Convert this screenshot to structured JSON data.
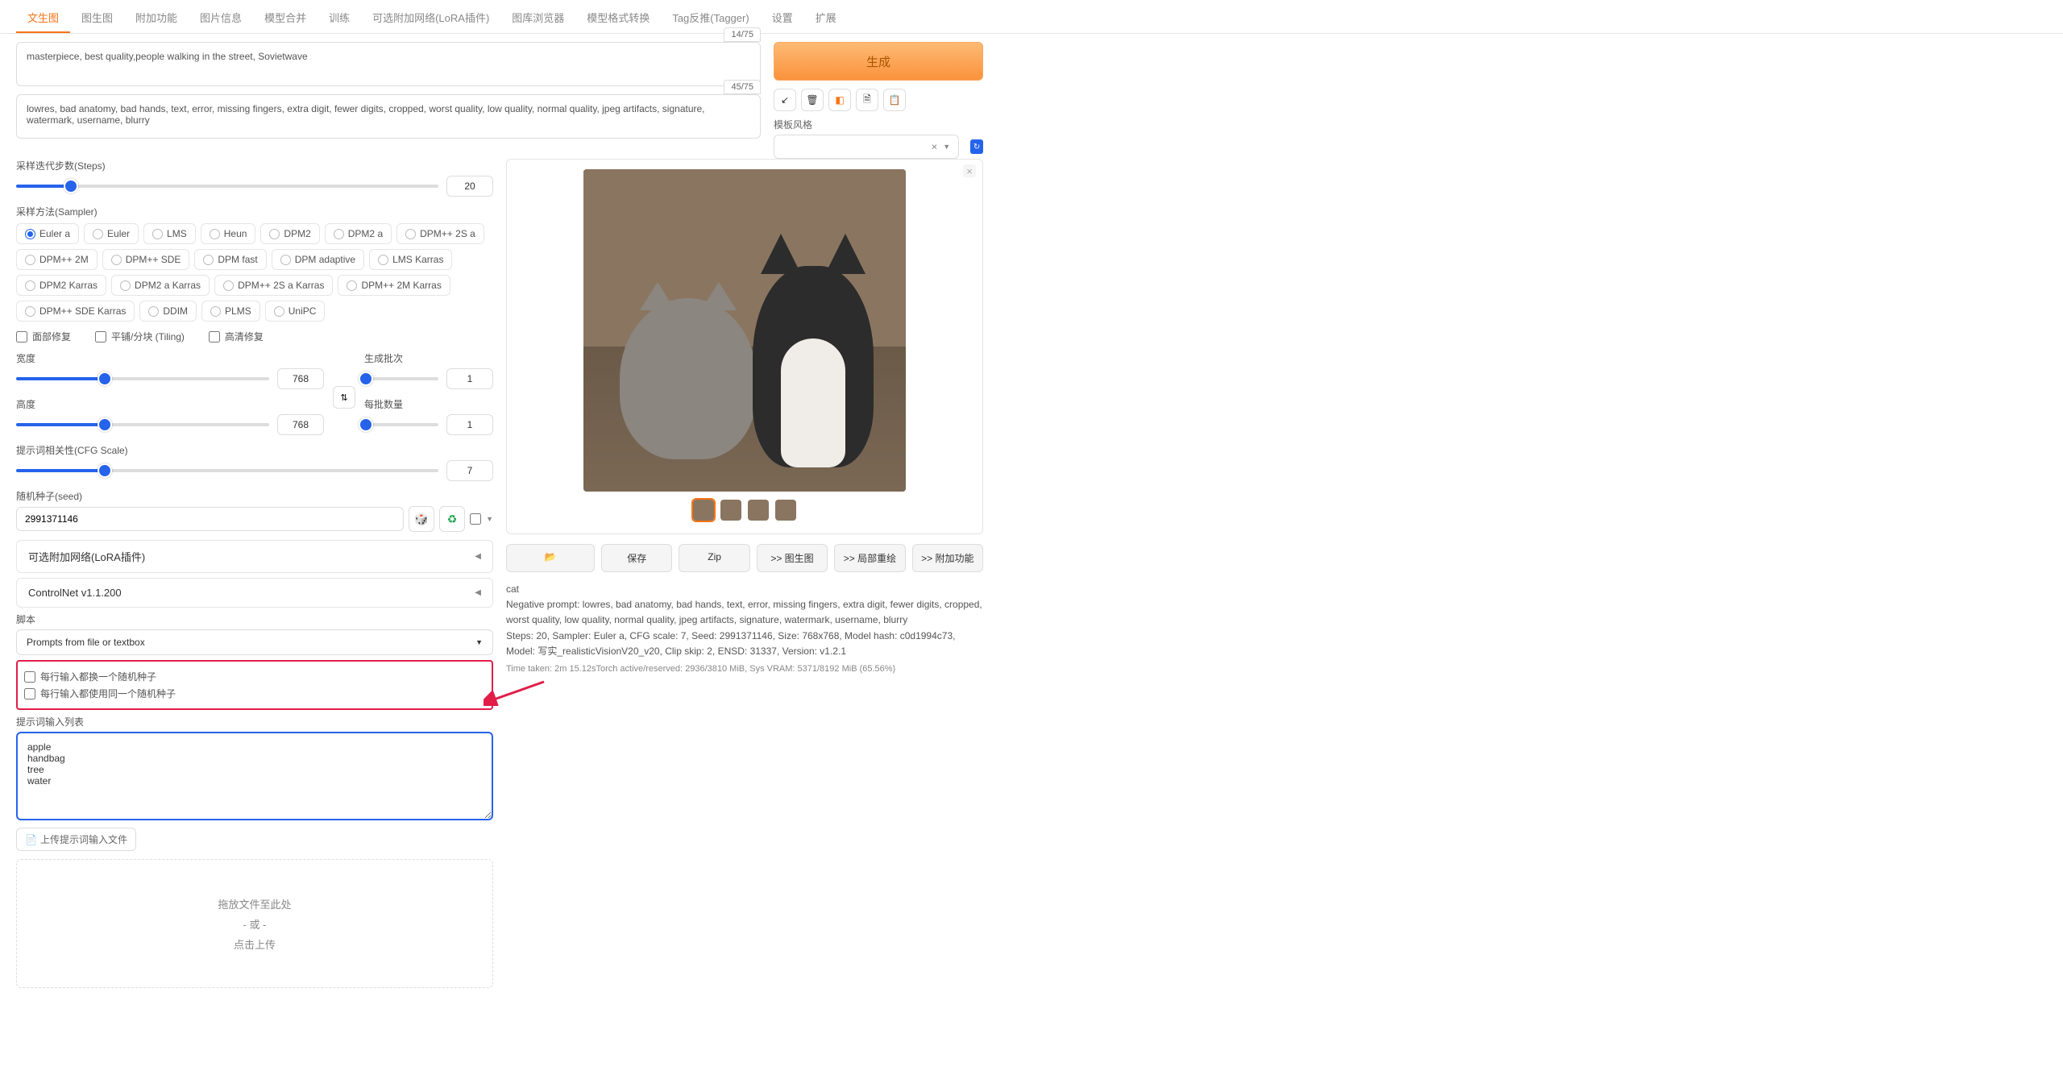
{
  "tabs": {
    "t0": "文生图",
    "t1": "图生图",
    "t2": "附加功能",
    "t3": "图片信息",
    "t4": "模型合并",
    "t5": "训练",
    "t6": "可选附加网络(LoRA插件)",
    "t7": "图库浏览器",
    "t8": "模型格式转换",
    "t9": "Tag反推(Tagger)",
    "t10": "设置",
    "t11": "扩展"
  },
  "prompt": {
    "positive": "masterpiece, best quality,people walking in the street, Sovietwave",
    "pos_count": "14/75",
    "negative": "lowres, bad anatomy, bad hands, text, error, missing fingers, extra digit, fewer digits, cropped, worst quality, low quality, normal quality, jpeg artifacts, signature, watermark, username, blurry",
    "neg_count": "45/75"
  },
  "generate": "生成",
  "style_label": "模板风格",
  "params": {
    "steps_label": "采样迭代步数(Steps)",
    "steps_val": "20",
    "sampler_label": "采样方法(Sampler)",
    "samplers": {
      "s0": "Euler a",
      "s1": "Euler",
      "s2": "LMS",
      "s3": "Heun",
      "s4": "DPM2",
      "s5": "DPM2 a",
      "s6": "DPM++ 2S a",
      "s7": "DPM++ 2M",
      "s8": "DPM++ SDE",
      "s9": "DPM fast",
      "s10": "DPM adaptive",
      "s11": "LMS Karras",
      "s12": "DPM2 Karras",
      "s13": "DPM2 a Karras",
      "s14": "DPM++ 2S a Karras",
      "s15": "DPM++ 2M Karras",
      "s16": "DPM++ SDE Karras",
      "s17": "DDIM",
      "s18": "PLMS",
      "s19": "UniPC"
    },
    "check_face": "面部修复",
    "check_tile": "平铺/分块 (Tiling)",
    "check_hires": "高清修复",
    "width_label": "宽度",
    "width_val": "768",
    "height_label": "高度",
    "height_val": "768",
    "batch_count_label": "生成批次",
    "batch_count_val": "1",
    "batch_size_label": "每批数量",
    "batch_size_val": "1",
    "cfg_label": "提示词相关性(CFG Scale)",
    "cfg_val": "7",
    "seed_label": "随机种子(seed)",
    "seed_val": "2991371146"
  },
  "accordions": {
    "lora": "可选附加网络(LoRA插件)",
    "controlnet": "ControlNet v1.1.200"
  },
  "script": {
    "label": "脚本",
    "selected": "Prompts from file or textbox"
  },
  "script_opts": {
    "c1": "每行输入都换一个随机种子",
    "c2": "每行输入都使用同一个随机种子",
    "list_label": "提示词输入列表",
    "list_val": "apple\nhandbag\ntree\nwater",
    "upload": "上传提示词输入文件",
    "drop1": "拖放文件至此处",
    "drop2": "- 或 -",
    "drop3": "点击上传"
  },
  "actions": {
    "save": "保存",
    "zip": "Zip",
    "img2img": ">> 图生图",
    "inpaint": ">> 局部重绘",
    "extras": ">> 附加功能"
  },
  "info": {
    "l1": "cat",
    "l2": "Negative prompt: lowres, bad anatomy, bad hands, text, error, missing fingers, extra digit, fewer digits, cropped, worst quality, low quality, normal quality, jpeg artifacts, signature, watermark, username, blurry",
    "l3": "Steps: 20, Sampler: Euler a, CFG scale: 7, Seed: 2991371146, Size: 768x768, Model hash: c0d1994c73, Model: 写实_realisticVisionV20_v20, Clip skip: 2, ENSD: 31337, Version: v1.2.1",
    "l4": "Time taken: 2m 15.12sTorch active/reserved: 2936/3810 MiB, Sys VRAM: 5371/8192 MiB (65.56%)"
  }
}
